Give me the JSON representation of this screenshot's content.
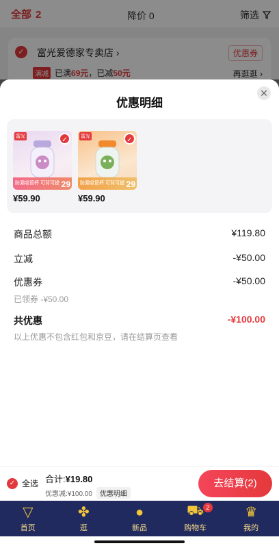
{
  "background": {
    "tab_all": "全部",
    "tab_all_count": "2",
    "tab_price_drop": "降价 0",
    "filter": "筛选",
    "store_name": "富光爱德家专卖店 ›",
    "coupon": "优惠券",
    "promo_tag": "满减",
    "promo_text_a": "已满",
    "promo_amount_a": "69元",
    "promo_text_b": "，已减",
    "promo_amount_b": "50元",
    "promo_more": "再逛逛 ›"
  },
  "sheet": {
    "title": "优惠明细",
    "close": "✕",
    "items": [
      {
        "price": "¥59.90",
        "label": "防漏吸管杯 可背可提",
        "num": "29",
        "brand": "富光"
      },
      {
        "price": "¥59.90",
        "label": "防漏吸管杯 可背可提",
        "num": "29",
        "brand": "富光"
      }
    ],
    "rows": {
      "total_label": "商品总额",
      "total_value": "¥119.80",
      "instant_label": "立减",
      "instant_value": "-¥50.00",
      "coupon_label": "优惠券",
      "coupon_value": "-¥50.00",
      "coupon_sub": "已领券 -¥50.00",
      "saving_label": "共优惠",
      "saving_value": "-¥100.00",
      "note": "以上优惠不包含红包和京豆，请在结算页查看"
    }
  },
  "cartbar": {
    "select_all": "全选",
    "sum_label": "合计:",
    "sum_value": "¥19.80",
    "discount": "优惠减:¥100.00",
    "detail": "优惠明细",
    "checkout": "去结算(2)"
  },
  "tabs": [
    {
      "label": "首页",
      "icon": "home-icon"
    },
    {
      "label": "逛",
      "icon": "explore-icon"
    },
    {
      "label": "新品",
      "icon": "new-icon"
    },
    {
      "label": "购物车",
      "icon": "cart-icon",
      "badge": "2"
    },
    {
      "label": "我的",
      "icon": "crown-icon"
    }
  ],
  "colors": {
    "accent": "#e4393c",
    "tabbar": "#202a5e"
  }
}
